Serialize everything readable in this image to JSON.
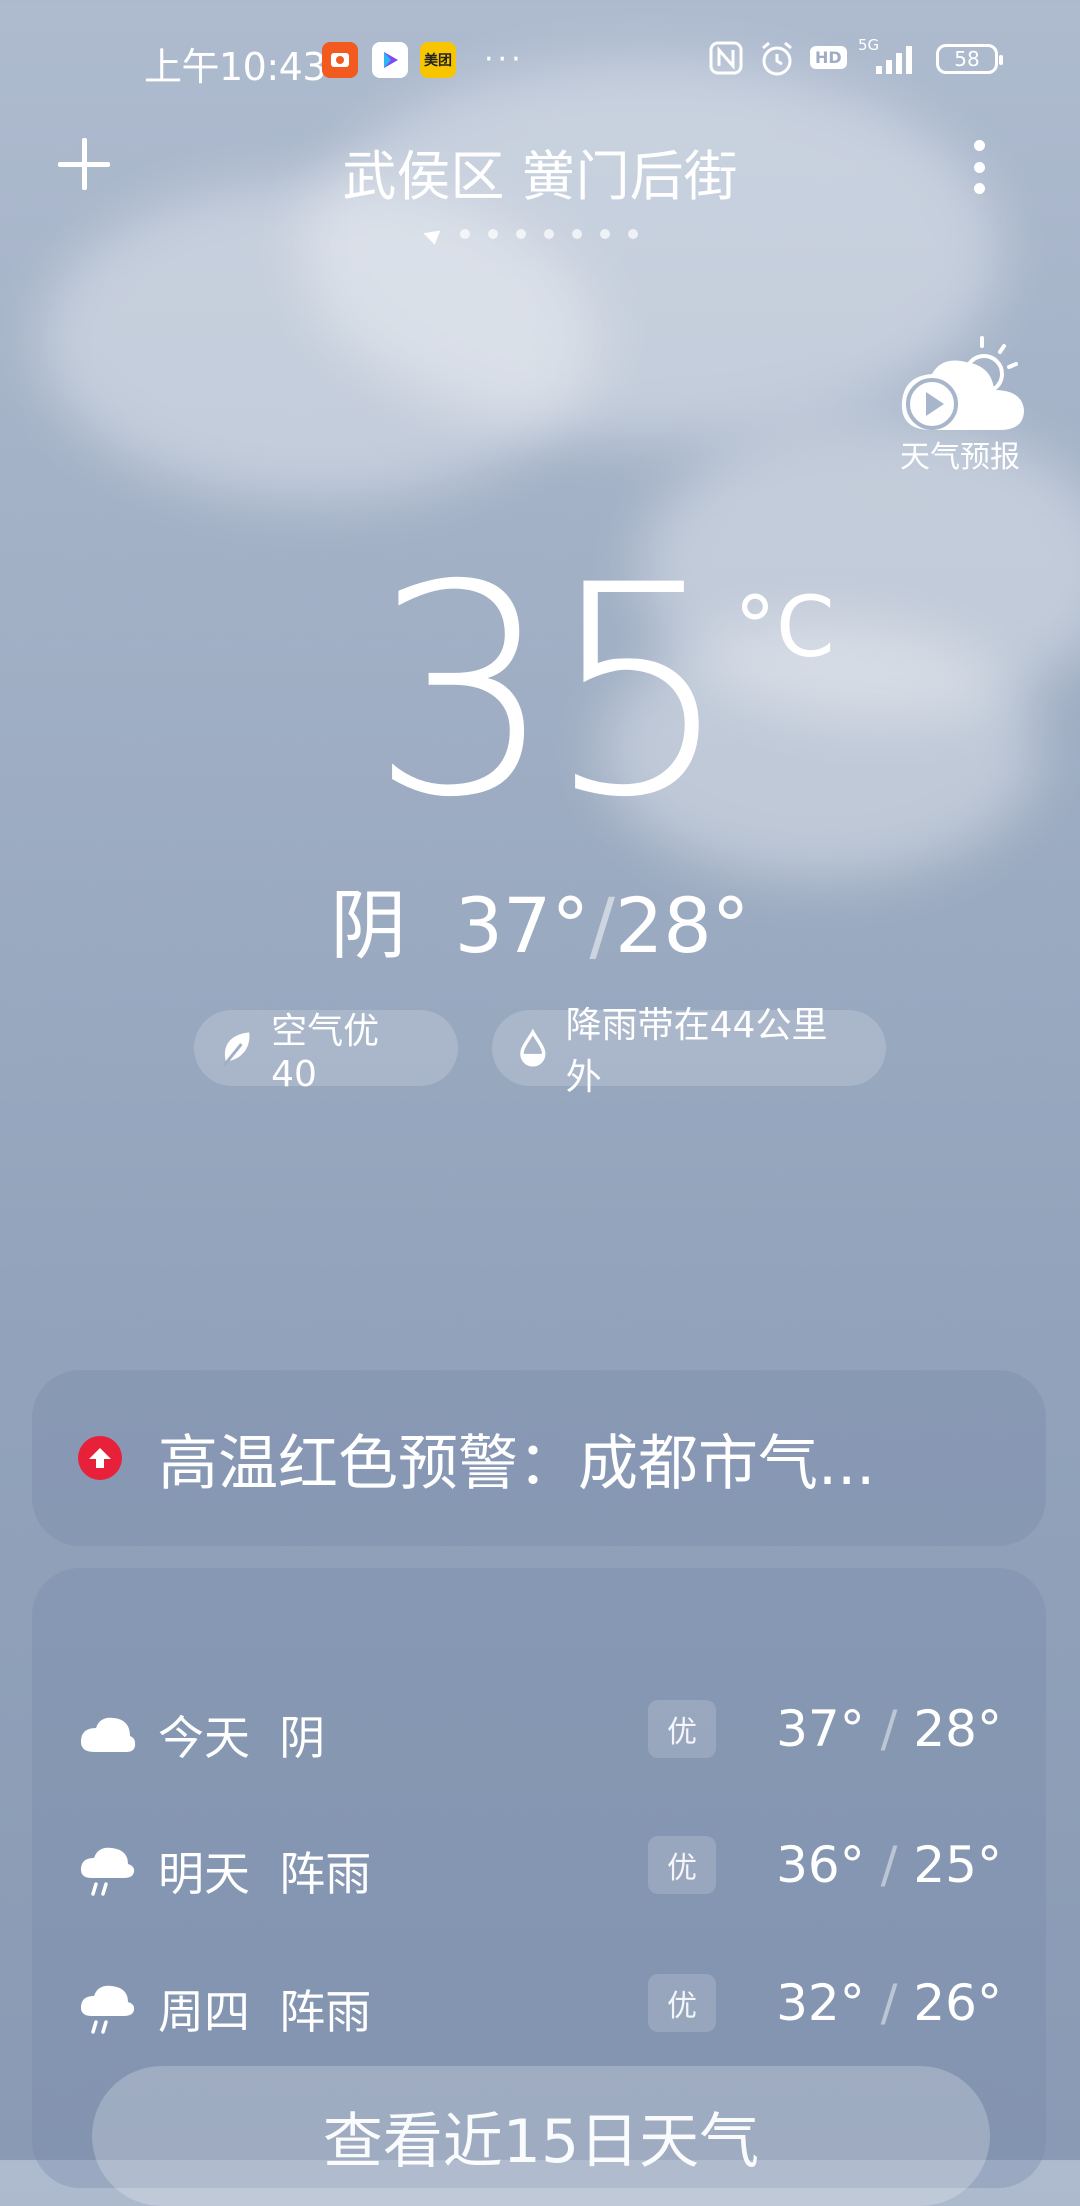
{
  "status_bar": {
    "time": "上午10:43",
    "apps": [
      {
        "name": "app-icon-orange",
        "text": "",
        "color": "#f25a1f"
      },
      {
        "name": "app-icon-play",
        "text": "",
        "color": "#ffffff"
      },
      {
        "name": "meituan-app-icon",
        "text": "美团",
        "color": "#f7c600"
      }
    ],
    "more": "···",
    "network": "5G",
    "hd": "HD",
    "battery": "58"
  },
  "header": {
    "location": "武侯区 黉门后街",
    "page_count": 7
  },
  "forecast_video": {
    "label": "天气预报"
  },
  "current": {
    "temperature": "35",
    "unit": "°C",
    "condition": "阴",
    "high": "37°",
    "low": "28°",
    "separator": "/"
  },
  "pills": {
    "air": "空气优 40",
    "rain": "降雨带在44公里外"
  },
  "alert": {
    "text": "高温红色预警：成都市气...",
    "color": "#e8213a"
  },
  "forecast": [
    {
      "day": "今天",
      "condition": "阴",
      "icon": "cloud-icon",
      "aqi": "优",
      "high": "37°",
      "low": "28°"
    },
    {
      "day": "明天",
      "condition": "阵雨",
      "icon": "rain-cloud-icon",
      "aqi": "优",
      "high": "36°",
      "low": "25°"
    },
    {
      "day": "周四",
      "condition": "阵雨",
      "icon": "rain-cloud-icon",
      "aqi": "优",
      "high": "32°",
      "low": "26°"
    }
  ],
  "forecast_15_button": "查看近15日天气"
}
